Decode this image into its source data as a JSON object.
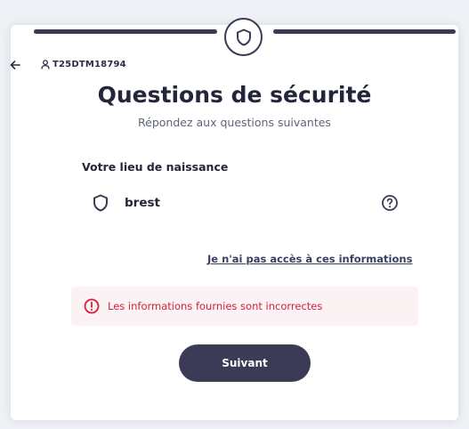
{
  "header": {
    "back_icon": "arrow-left-icon",
    "user_icon": "user-icon",
    "user_id": "T25DTM18794",
    "badge_icon": "shield-icon"
  },
  "main": {
    "title": "Questions de sécurité",
    "subtitle": "Répondez aux questions suivantes",
    "question_label": "Votre lieu de naissance",
    "answer_value": "brest",
    "answer_icon": "shield-icon",
    "help_icon": "question-circle-icon",
    "no_access_link": "Je n'ai pas accès à ces informations",
    "error_icon": "alert-circle-icon",
    "error_message": "Les informations fournies sont incorrectes",
    "next_button": "Suivant"
  },
  "colors": {
    "primary": "#3b3b55",
    "error": "#d3213f",
    "error_bg": "#fbf2f4",
    "background": "#eef1f5"
  }
}
